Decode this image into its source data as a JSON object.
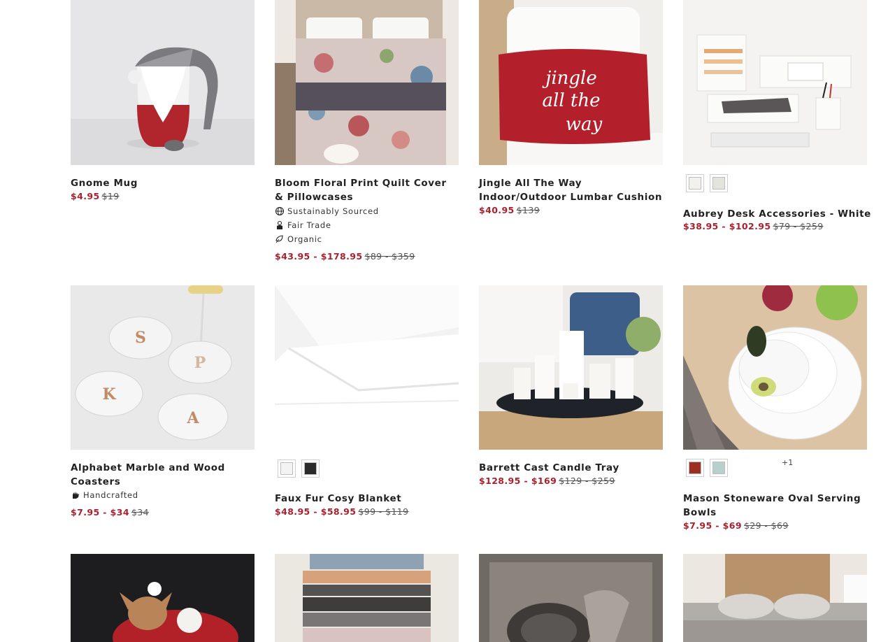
{
  "products": [
    {
      "name": "Gnome Mug",
      "sale": "$4.95",
      "original": "$19"
    },
    {
      "name": "Bloom Floral Print Quilt Cover & Pillowcases",
      "attributes": [
        {
          "icon": "globe-icon",
          "label": "Sustainably Sourced"
        },
        {
          "icon": "hand-coin-icon",
          "label": "Fair Trade"
        },
        {
          "icon": "leaf-icon",
          "label": "Organic"
        }
      ],
      "sale": "$43.95 - $178.95",
      "original": "$89 - $359"
    },
    {
      "name": "Jingle All The Way Indoor/Outdoor Lumbar Cushion",
      "sale": "$40.95",
      "original": "$139"
    },
    {
      "name": "Aubrey Desk Accessories - White",
      "swatches": [
        "#f2f1ec",
        "#e4e4df"
      ],
      "sale": "$38.95 - $102.95",
      "original": "$79 - $259"
    },
    {
      "name": "Alphabet Marble and Wood Coasters",
      "attributes": [
        {
          "icon": "hand-icon",
          "label": "Handcrafted"
        }
      ],
      "sale": "$7.95 - $34",
      "original": "$34"
    },
    {
      "name": "Faux Fur Cosy Blanket",
      "swatches": [
        "#f3f3f3",
        "#2b2b2b"
      ],
      "sale": "$48.95 - $58.95",
      "original": "$99 - $119"
    },
    {
      "name": "Barrett Cast Candle Tray",
      "sale": "$128.95 - $169",
      "original": "$129 - $259"
    },
    {
      "name": "Mason Stoneware Oval Serving Bowls",
      "swatches": [
        "#9a3023",
        "#b7cfcd"
      ],
      "more": "+1",
      "sale": "$7.95 - $69",
      "original": "$29 - $69"
    }
  ],
  "colors": {
    "sale": "#a8212e",
    "text": "#222222",
    "swatch_border": "#cfcfcf"
  }
}
